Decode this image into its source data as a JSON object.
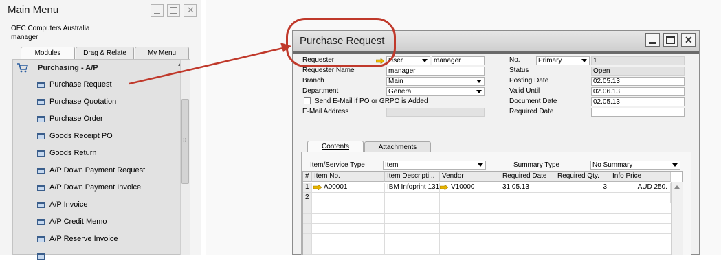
{
  "main_menu": {
    "title": "Main Menu",
    "company": "OEC Computers Australia",
    "user": "manager",
    "tabs": [
      {
        "label": "Modules"
      },
      {
        "label": "Drag & Relate"
      },
      {
        "label": "My Menu"
      }
    ],
    "module_header": "Purchasing - A/P",
    "items": [
      {
        "label": "Purchase Request"
      },
      {
        "label": "Purchase Quotation"
      },
      {
        "label": "Purchase Order"
      },
      {
        "label": "Goods Receipt PO"
      },
      {
        "label": "Goods Return"
      },
      {
        "label": "A/P Down Payment Request"
      },
      {
        "label": "A/P Down Payment Invoice"
      },
      {
        "label": "A/P Invoice"
      },
      {
        "label": "A/P Credit Memo"
      },
      {
        "label": "A/P Reserve Invoice"
      }
    ]
  },
  "purchase_request": {
    "title": "Purchase Request",
    "left_fields": {
      "requester": {
        "label": "Requester",
        "type_value": "User",
        "value": "manager"
      },
      "requester_name": {
        "label": "Requester Name",
        "value": "manager"
      },
      "branch": {
        "label": "Branch",
        "value": "Main"
      },
      "department": {
        "label": "Department",
        "value": "General"
      },
      "send_email": {
        "label": "Send E-Mail if PO or GRPO is Added"
      },
      "email": {
        "label": "E-Mail Address",
        "value": ""
      }
    },
    "right_fields": {
      "no": {
        "label": "No.",
        "series": "Primary",
        "value": "1"
      },
      "status": {
        "label": "Status",
        "value": "Open"
      },
      "posting_date": {
        "label": "Posting Date",
        "value": "02.05.13"
      },
      "valid_until": {
        "label": "Valid Until",
        "value": "02.06.13"
      },
      "document_date": {
        "label": "Document Date",
        "value": "02.05.13"
      },
      "required_date": {
        "label": "Required Date",
        "value": ""
      }
    },
    "tabs": [
      {
        "label": "Contents"
      },
      {
        "label": "Attachments"
      }
    ],
    "item_service_type": {
      "label": "Item/Service Type",
      "value": "Item"
    },
    "summary_type": {
      "label": "Summary Type",
      "value": "No Summary"
    },
    "grid": {
      "columns": [
        "#",
        "Item No.",
        "Item Descripti...",
        "Vendor",
        "Required Date",
        "Required Qty.",
        "Info Price"
      ],
      "rows": [
        {
          "num": "1",
          "item_no": "A00001",
          "desc": "IBM Infoprint 131",
          "vendor": "V10000",
          "required_date": "31.05.13",
          "qty": "3",
          "price": "AUD 250."
        },
        {
          "num": "2",
          "item_no": "",
          "desc": "",
          "vendor": "",
          "required_date": "",
          "qty": "",
          "price": ""
        }
      ]
    }
  },
  "colors": {
    "highlight": "#c0392b",
    "link_arrow": "#e8b400"
  }
}
